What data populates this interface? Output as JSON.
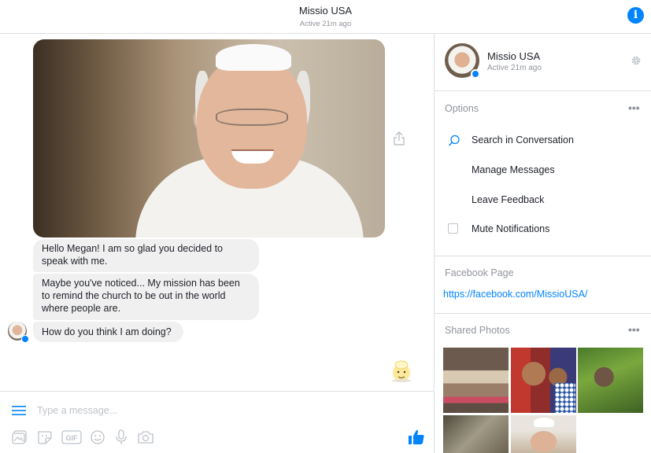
{
  "header": {
    "title": "Missio USA",
    "subtitle": "Active 21m ago",
    "info_icon": "info-icon"
  },
  "chat": {
    "messages": [
      {
        "type": "photo",
        "content": "Portrait photo"
      },
      {
        "type": "text",
        "text": "Hello Megan! I am so glad you decided to speak with me."
      },
      {
        "type": "text",
        "text": "Maybe you've noticed... My mission has been to remind the church to be out in the world where people are."
      },
      {
        "type": "text",
        "text": "How do you think I am doing?"
      }
    ],
    "share_icon": "share-icon",
    "sticker_icon": "sticker-icon"
  },
  "composer": {
    "placeholder": "Type a message...",
    "tools": [
      "image-icon",
      "sticker-icon",
      "gif-icon",
      "emoji-icon",
      "microphone-icon",
      "camera-icon"
    ],
    "like_icon": "thumbs-up-icon",
    "accent": "#0084ff"
  },
  "sidebar": {
    "profile": {
      "name": "Missio USA",
      "status": "Active 21m ago"
    },
    "options": {
      "title": "Options",
      "more": "•••",
      "items": [
        {
          "label": "Search in Conversation",
          "icon": "search-icon"
        },
        {
          "label": "Manage Messages"
        },
        {
          "label": "Leave Feedback"
        },
        {
          "label": "Mute Notifications",
          "icon": "checkbox"
        }
      ]
    },
    "facebook_page": {
      "title": "Facebook Page",
      "link": "https://facebook.com/MissioUSA/"
    },
    "shared_photos": {
      "title": "Shared Photos",
      "more": "•••",
      "count_visible": 5
    }
  }
}
